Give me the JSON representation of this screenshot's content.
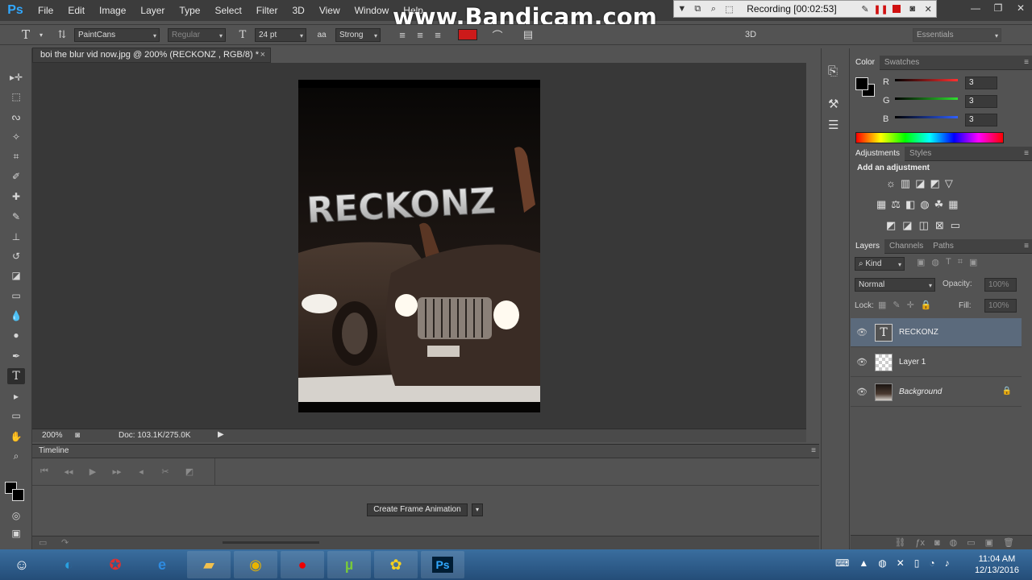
{
  "app": {
    "logo": "Ps",
    "watermark": "www.Bandicam.com"
  },
  "menu": [
    "File",
    "Edit",
    "Image",
    "Layer",
    "Type",
    "Select",
    "Filter",
    "3D",
    "View",
    "Window",
    "Help"
  ],
  "recorder": {
    "status": "Recording [00:02:53]"
  },
  "options_bar": {
    "font_family": "PaintCans",
    "font_style": "Regular",
    "font_size": "24 pt",
    "anti_alias_icon": "aa",
    "anti_alias": "Strong",
    "color_swatch": "#cc1a1a",
    "threed_label": "3D",
    "workspace": "Essentials"
  },
  "document": {
    "tab_title": "boi the blur vid now.jpg @ 200% (RECKONZ , RGB/8) *",
    "close": "×",
    "text_layer_content": "RECKONZ",
    "zoom": "200%",
    "doc_info": "Doc: 103.1K/275.0K"
  },
  "timeline": {
    "title": "Timeline",
    "create_button": "Create Frame Animation"
  },
  "color_panel": {
    "tabs": [
      "Color",
      "Swatches"
    ],
    "channels": [
      {
        "label": "R",
        "value": "3",
        "color": "#ff3030"
      },
      {
        "label": "G",
        "value": "3",
        "color": "#30e030"
      },
      {
        "label": "B",
        "value": "3",
        "color": "#3060ff"
      }
    ]
  },
  "adjustments_panel": {
    "tabs": [
      "Adjustments",
      "Styles"
    ],
    "heading": "Add an adjustment"
  },
  "layers_panel": {
    "tabs": [
      "Layers",
      "Channels",
      "Paths"
    ],
    "filter_kind": "Kind",
    "blend_mode": "Normal",
    "opacity_label": "Opacity:",
    "opacity_value": "100%",
    "lock_label": "Lock:",
    "fill_label": "Fill:",
    "fill_value": "100%",
    "layers": [
      {
        "name": "RECKONZ",
        "type": "text",
        "selected": true
      },
      {
        "name": "Layer 1",
        "type": "pixel",
        "selected": false
      },
      {
        "name": "Background",
        "type": "image",
        "selected": false,
        "locked": true
      }
    ]
  },
  "taskbar": {
    "time": "11:04 AM",
    "date": "12/13/2016"
  }
}
